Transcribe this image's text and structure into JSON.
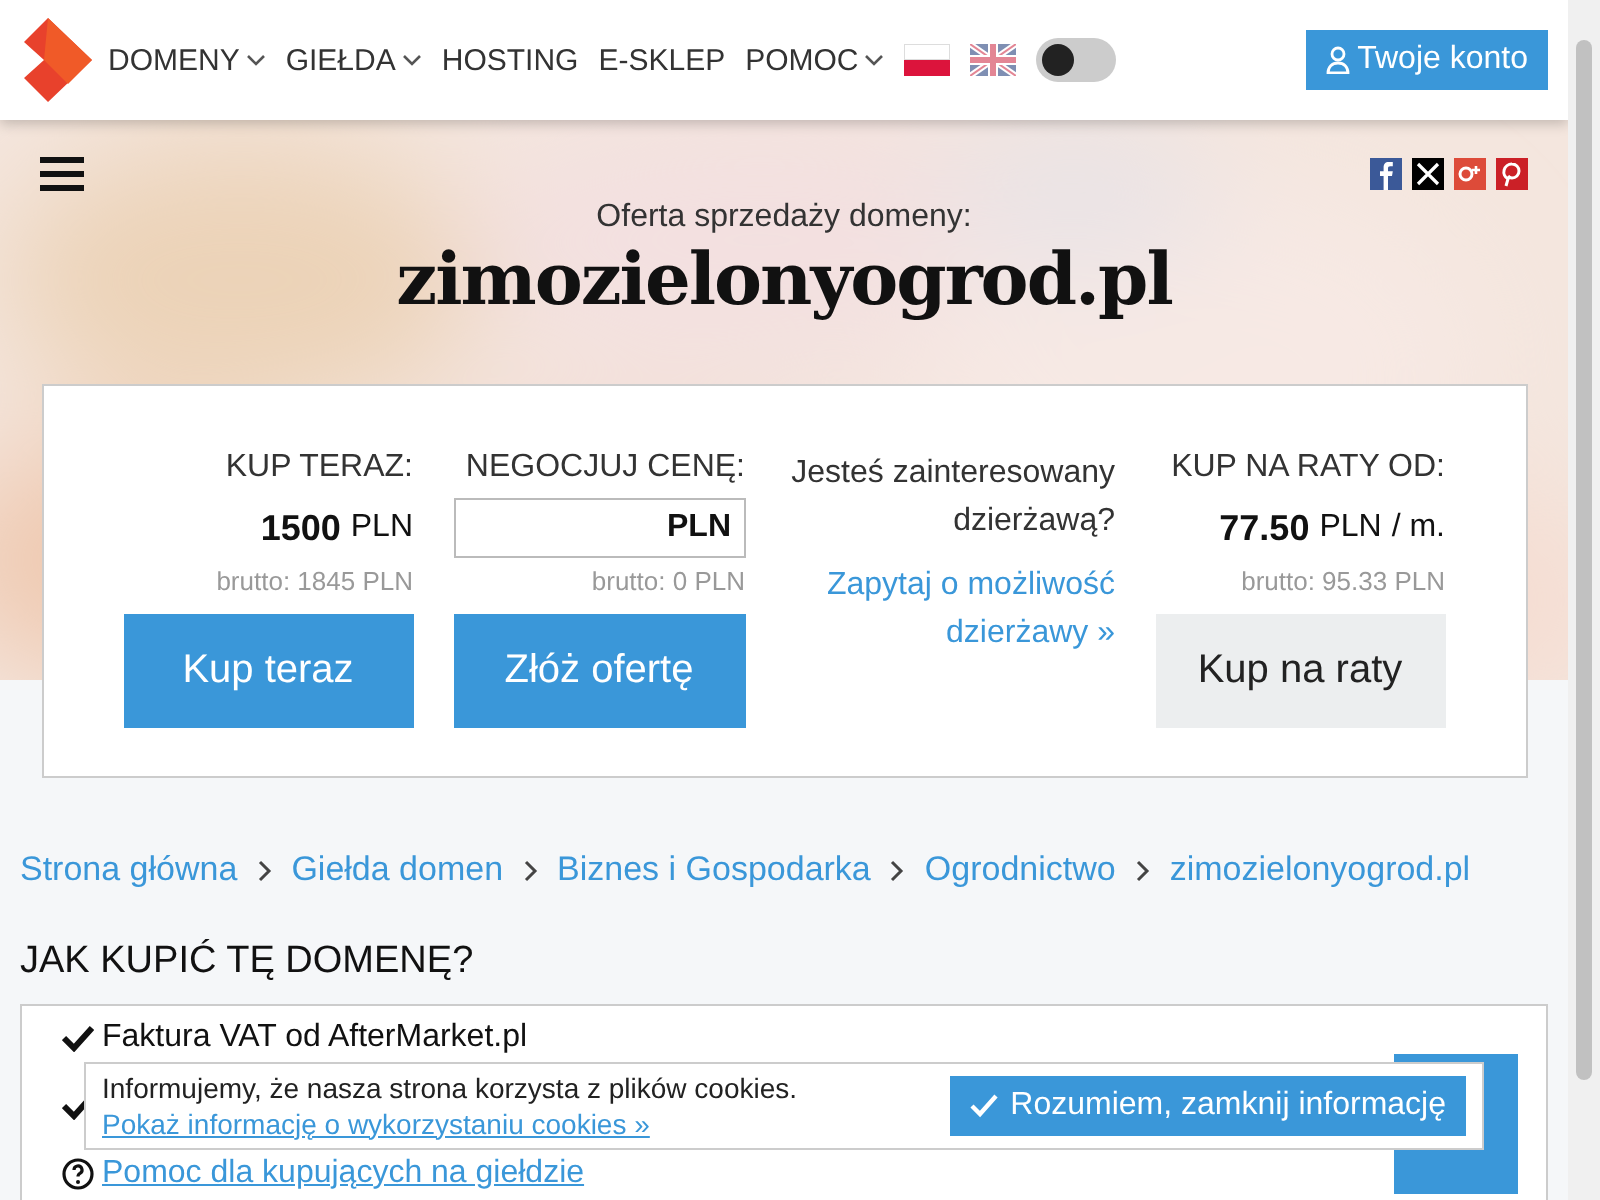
{
  "header": {
    "nav": [
      {
        "label": "DOMENY",
        "dropdown": true
      },
      {
        "label": "GIEŁDA",
        "dropdown": true
      },
      {
        "label": "HOSTING",
        "dropdown": false
      },
      {
        "label": "E-SKLEP",
        "dropdown": false
      },
      {
        "label": "POMOC",
        "dropdown": true
      }
    ],
    "languages": [
      {
        "kind": "pl",
        "selected": true
      },
      {
        "kind": "en",
        "selected": false
      }
    ],
    "dark_mode": {
      "on": false
    },
    "account_button": "Twoje konto"
  },
  "hero": {
    "subtitle": "Oferta sprzedaży domeny:",
    "domain": "zimozielonyogrod.pl",
    "share": [
      {
        "kind": "facebook"
      },
      {
        "kind": "x"
      },
      {
        "kind": "googleplus"
      },
      {
        "kind": "pinterest"
      }
    ]
  },
  "offer": {
    "columns": [
      {
        "kind": "price",
        "label": "KUP TERAZ:",
        "amount": "1500",
        "currency": "PLN",
        "gross": "brutto: 1845 PLN",
        "button": "Kup teraz"
      },
      {
        "kind": "input",
        "label": "NEGOCJUJ CENĘ:",
        "currency": "PLN",
        "gross": "brutto: 0 PLN",
        "button": "Złóż ofertę"
      },
      {
        "kind": "lease",
        "question": "Jesteś zainteresowany dzierżawą?",
        "link": "Zapytaj o możliwość dzierżawy »"
      },
      {
        "kind": "installment",
        "label": "KUP NA RATY OD:",
        "amount": "77.50",
        "currency": "PLN",
        "suffix": "/ m.",
        "gross": "brutto: 95.33 PLN",
        "button": "Kup na raty"
      }
    ]
  },
  "breadcrumb": [
    "Strona główna",
    "Giełda domen",
    "Biznes i Gospodarka",
    "Ogrodnictwo",
    "zimozielonyogrod.pl"
  ],
  "how_to": {
    "title": "JAK KUPIĆ TĘ DOMENĘ?",
    "items": [
      {
        "kind": "check",
        "text": "Faktura VAT od AfterMarket.pl"
      },
      {
        "kind": "check"
      },
      {
        "kind": "help",
        "text": "Pomoc dla kupujących na giełdzie"
      }
    ]
  },
  "cookie_bar": {
    "text": "Informujemy, że nasza strona korzysta z plików cookies.",
    "link": "Pokaż informację o wykorzystaniu cookies »",
    "button": "Rozumiem, zamknij informację"
  }
}
